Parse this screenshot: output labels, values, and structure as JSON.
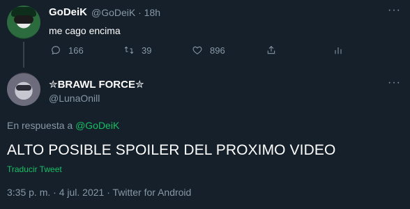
{
  "parent_tweet": {
    "display_name": "GoDeiK",
    "handle_time": "@GoDeiK · 18h",
    "text": "me cago encima",
    "more": "···",
    "actions": {
      "replies": "166",
      "retweets": "39",
      "likes": "896"
    }
  },
  "main_tweet": {
    "display_name": "✮BRAWL FORCE✮",
    "handle": "@LunaOnill",
    "more": "···",
    "reply_prefix": "En respuesta a ",
    "reply_mention": "@GoDeiK",
    "text": "ALTO POSIBLE SPOILER DEL PROXIMO VIDEO",
    "translate_label": "Traducir Tweet",
    "timestamp": "3:35 p. m. · 4 jul. 2021 · Twitter for Android"
  },
  "colors": {
    "background": "#15202b",
    "muted": "#8899a6",
    "accent_green": "#17bf63",
    "divider": "#38444d"
  }
}
